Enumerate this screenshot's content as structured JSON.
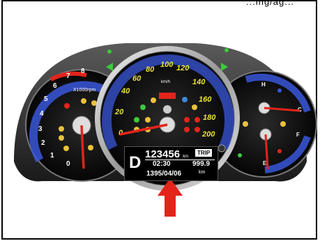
{
  "header": {
    "clipped_text": "...ing/ag..."
  },
  "tachometer": {
    "unit_label": "X1000rpm",
    "ticks": [
      "0",
      "1",
      "2",
      "3",
      "4",
      "5",
      "6",
      "7",
      "8"
    ]
  },
  "speedometer": {
    "unit_label": "km/h",
    "ticks": [
      "0",
      "20",
      "40",
      "60",
      "80",
      "100",
      "120",
      "140",
      "160",
      "180",
      "200"
    ]
  },
  "gauges": {
    "temp_hot": "H",
    "temp_cold": "C",
    "fuel_full": "F",
    "fuel_empty": "E"
  },
  "display": {
    "gear": "D",
    "odometer": "123456",
    "odometer_unit": "km",
    "trip_label": "TRIP",
    "time": "02:30",
    "trip_value": "999.9",
    "trip_unit": "km",
    "date": "1395/04/06"
  },
  "colors": {
    "accent_red": "#e3241b",
    "indicator_green": "#3ccb3c",
    "dial_blue": "#3a57d9",
    "tick_yellow": "#e8e23c"
  }
}
